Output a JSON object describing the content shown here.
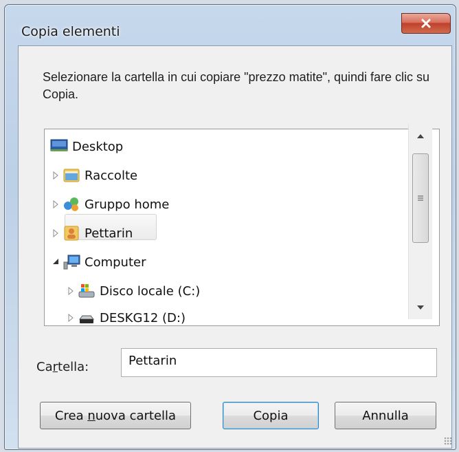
{
  "window": {
    "title": "Copia elementi",
    "close_icon": "close-icon"
  },
  "instruction": "Selezionare la cartella in cui copiare \"prezzo matite\", quindi fare clic su Copia.",
  "tree": {
    "items": [
      {
        "label": "Desktop",
        "icon": "desktop-icon",
        "expander": "none"
      },
      {
        "label": "Raccolte",
        "icon": "libraries-icon",
        "expander": "collapsed"
      },
      {
        "label": "Gruppo home",
        "icon": "homegroup-icon",
        "expander": "collapsed"
      },
      {
        "label": "Pettarin",
        "icon": "user-folder-icon",
        "expander": "collapsed",
        "selected": true
      },
      {
        "label": "Computer",
        "icon": "computer-icon",
        "expander": "expanded"
      },
      {
        "label": "Disco locale (C:)",
        "icon": "local-disk-icon",
        "expander": "collapsed"
      },
      {
        "label": "DESKG12 (D:)",
        "icon": "drive-icon",
        "expander": "collapsed"
      }
    ]
  },
  "folder": {
    "label_pre": "Ca",
    "label_accel": "r",
    "label_post": "tella:",
    "value": "Pettarin"
  },
  "buttons": {
    "new_folder_pre": "Crea ",
    "new_folder_accel": "n",
    "new_folder_post": "uova cartella",
    "copy": "Copia",
    "cancel": "Annulla"
  },
  "colors": {
    "accent_border": "#3c7fb1",
    "close_red": "#c0402c"
  }
}
